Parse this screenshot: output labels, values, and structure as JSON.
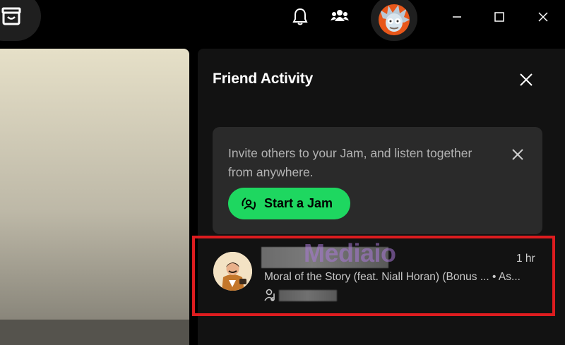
{
  "friend_activity": {
    "title": "Friend Activity"
  },
  "jam_card": {
    "text": "Invite others to your Jam, and listen together from anywhere.",
    "button_label": "Start a Jam"
  },
  "friend": {
    "watermark": "Mediaio",
    "time": "1 hr",
    "track": "Moral of the Story (feat. Niall Horan) (Bonus ... • As..."
  },
  "colors": {
    "background": "#000000",
    "panel": "#121212",
    "card": "#2a2a2a",
    "accent": "#1ed760",
    "highlight": "#dd1c1f"
  },
  "icons": [
    "store-icon",
    "bell-icon",
    "friends-icon",
    "user-avatar",
    "minimize-icon",
    "maximize-icon",
    "close-icon",
    "jam-icon",
    "artist-icon"
  ]
}
